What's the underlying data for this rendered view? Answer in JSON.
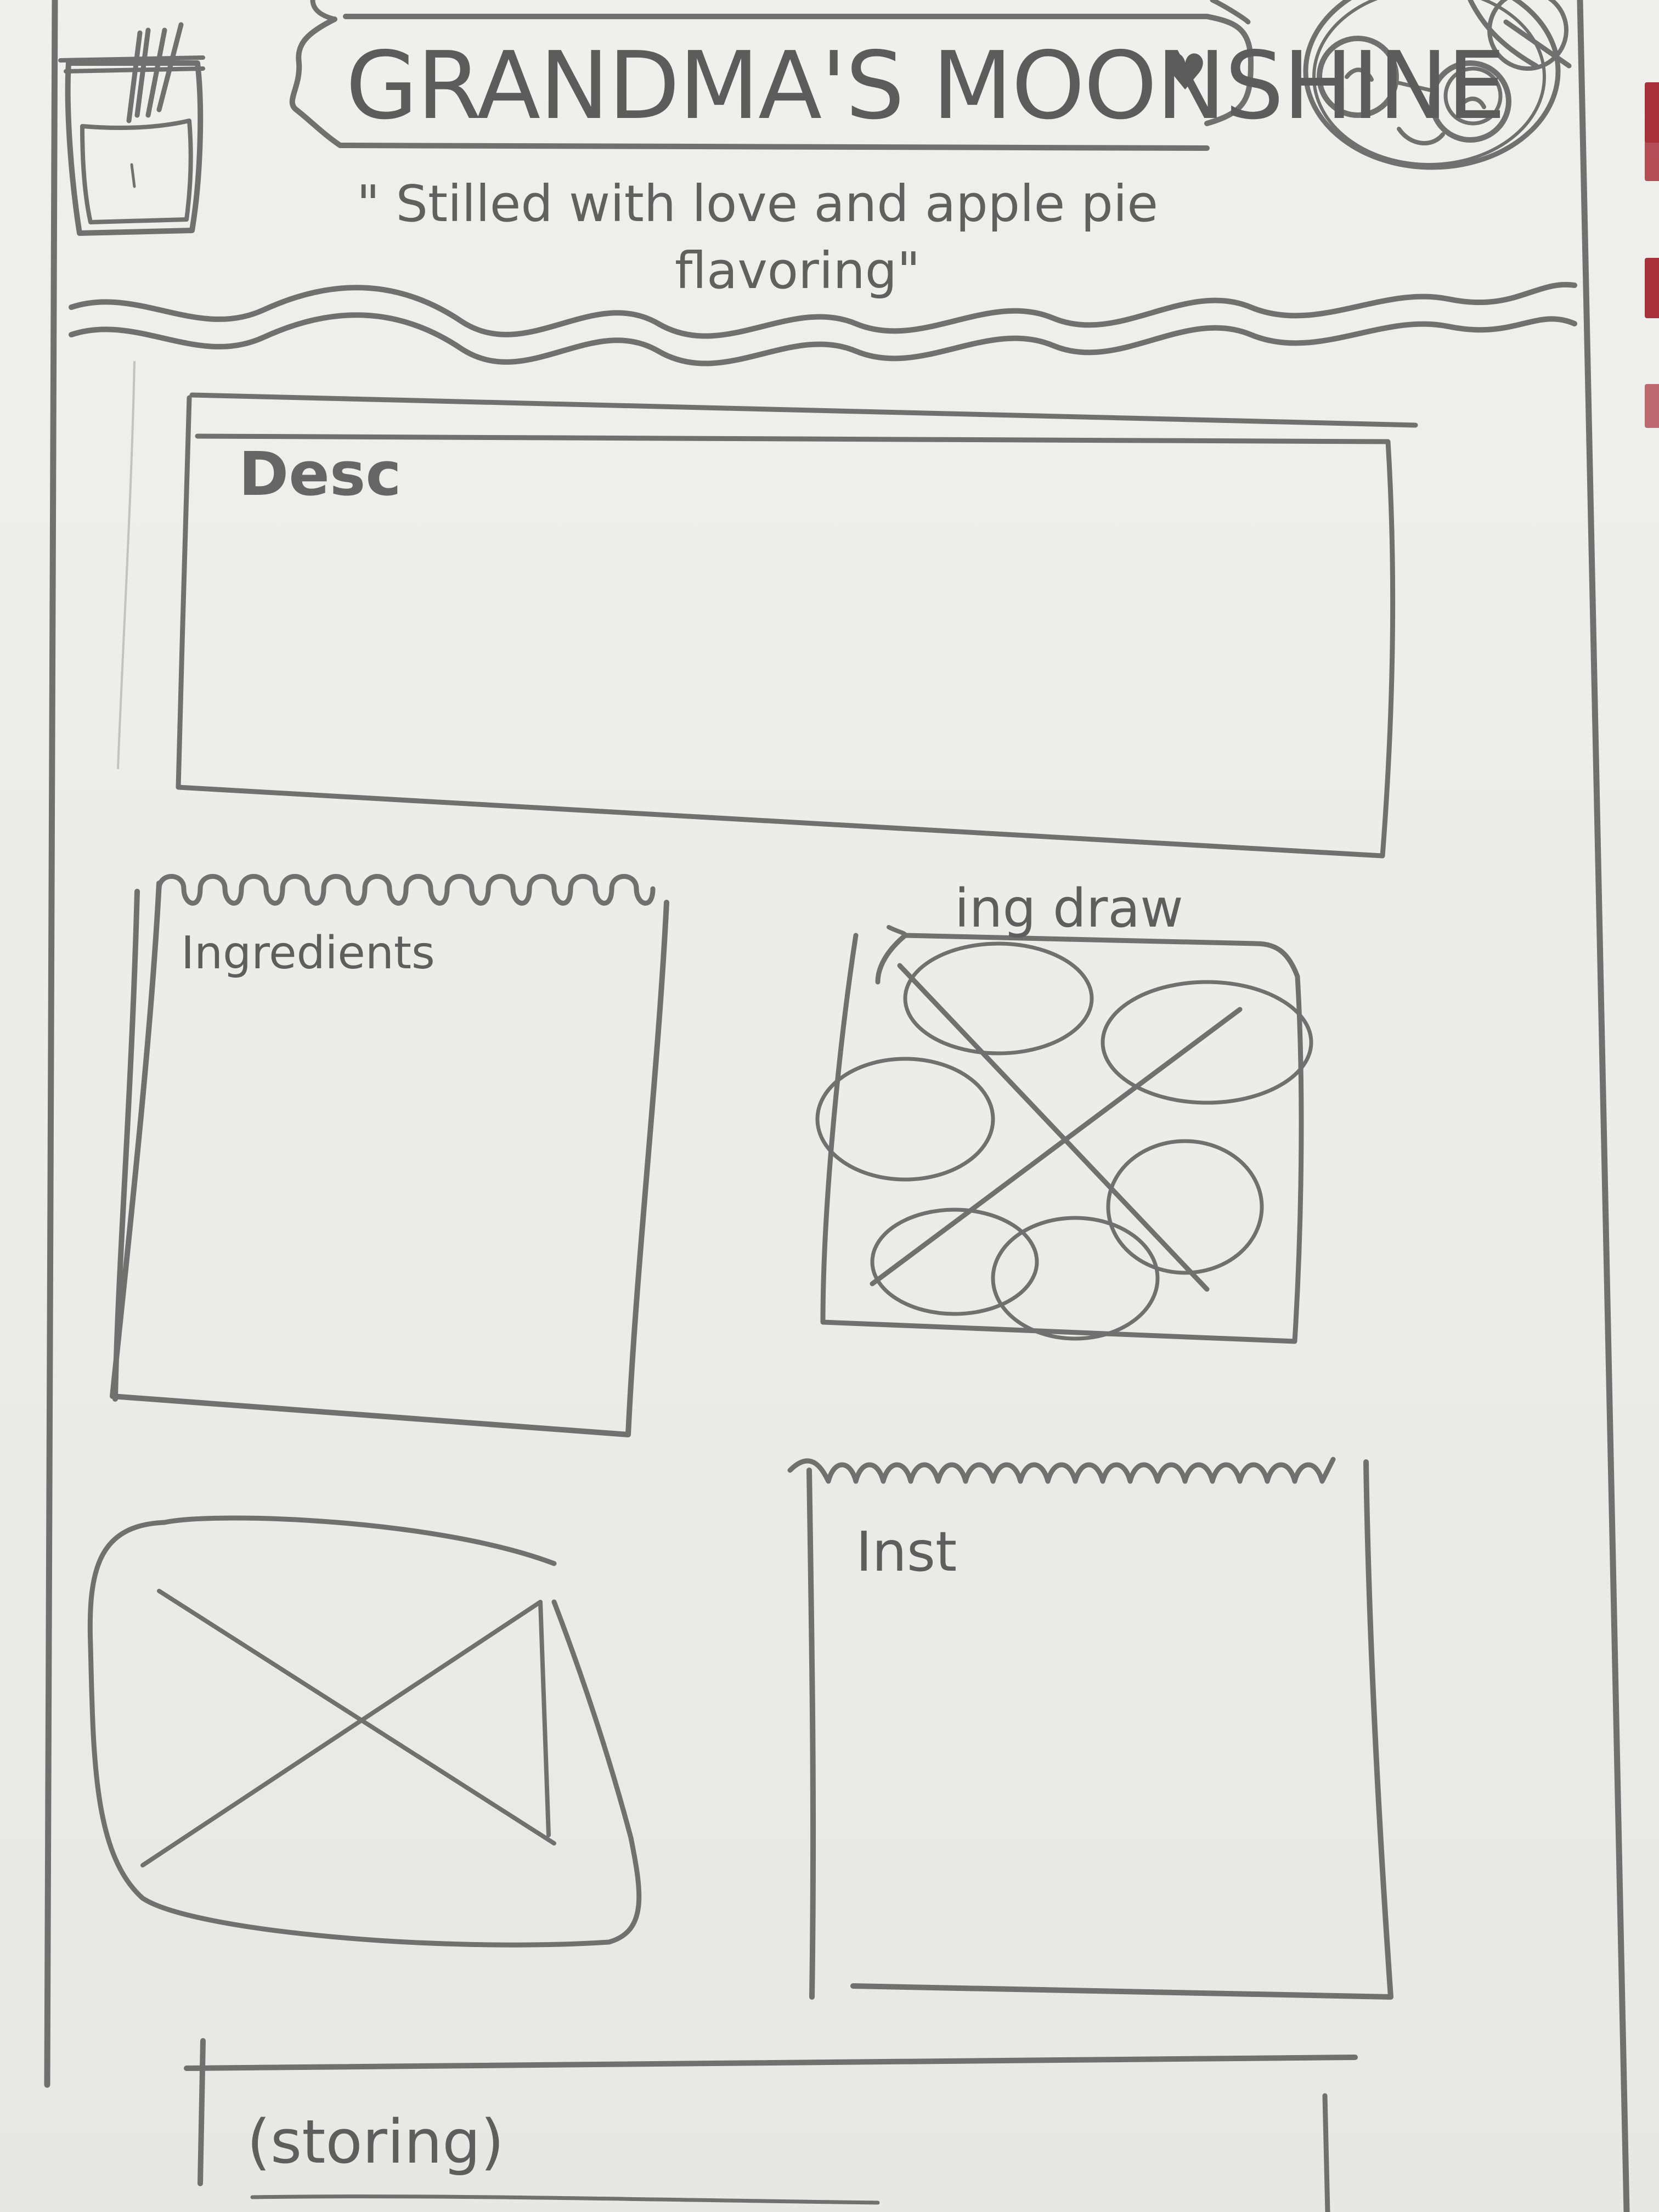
{
  "header": {
    "title": "GRANDMA'S MOONSHINE",
    "heart": "♥",
    "tagline_line1": "\" Stilled with love and apple pie",
    "tagline_line2": "flavoring\""
  },
  "icons": {
    "jar": "jar-icon",
    "grandma": "grandma-avatar-icon"
  },
  "sections": {
    "description_label": "Desc",
    "ingredients_label": "Ingredients",
    "ingredient_drawing_label": "ing draw",
    "instructions_label": "Inst",
    "storing_label": "(storing)"
  },
  "colors": {
    "pencil": "#707070",
    "paper": "#ececea",
    "red_tab": "#a8303a"
  }
}
